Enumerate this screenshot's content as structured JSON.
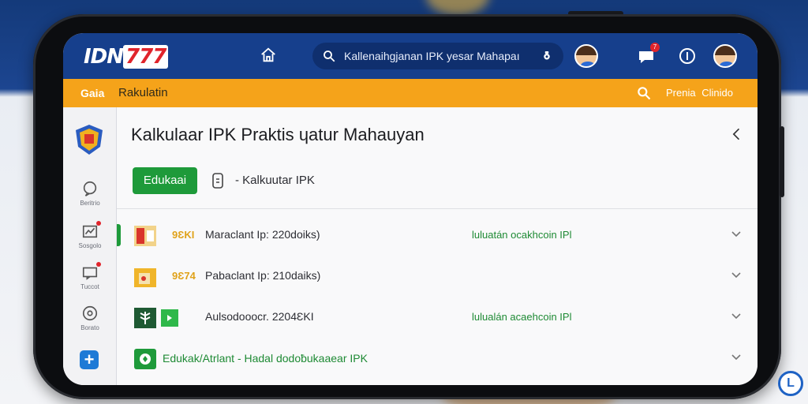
{
  "app": {
    "logo_text_main": "IDN",
    "logo_text_accent": "777"
  },
  "topbar": {
    "search_placeholder": "Kallenaihgjanan IPK yesar Mahapaı",
    "notification_count": "7",
    "accent_color": "#163f8c"
  },
  "orange_bar": {
    "home_label": "Gaia",
    "calc_label": "Rakulatin",
    "links_label": "Prenia  Clinido",
    "color": "#f5a31a"
  },
  "rail": {
    "items": [
      {
        "label": "Beritrio",
        "icon": "chat-icon"
      },
      {
        "label": "Sosgolo",
        "icon": "chart-icon"
      },
      {
        "label": "Tuccot",
        "icon": "message-icon"
      },
      {
        "label": "Borato",
        "icon": "settings-icon"
      }
    ]
  },
  "main": {
    "title": "Kalkulaar IPK Praktis ɥatur Mahauyan",
    "pill_label": "Edukaai",
    "breadcrumb": "- Kalkuutar IPK",
    "rows": [
      {
        "code": "9ƐKI",
        "title": "Maraclant Ip: 220doiks)",
        "link": "luluatán ocakhcoin IPl",
        "code_color": "#e0a21a"
      },
      {
        "code": "9Ɛ74",
        "title": "Pabaclant Ip: 210daiks)",
        "link": "",
        "code_color": "#e0a21a"
      },
      {
        "code": "",
        "title": "Aulsodooocr. 2204ƐKI",
        "link": "lulualán acaehcoin IPl",
        "code_color": "#1e9a3a"
      },
      {
        "code": "",
        "title": "Edukak/Atrlant - Hadal  dodoƀukaaear IPK",
        "link": "",
        "code_color": "#1e9a3a"
      }
    ]
  },
  "corner": {
    "badge": "L"
  }
}
